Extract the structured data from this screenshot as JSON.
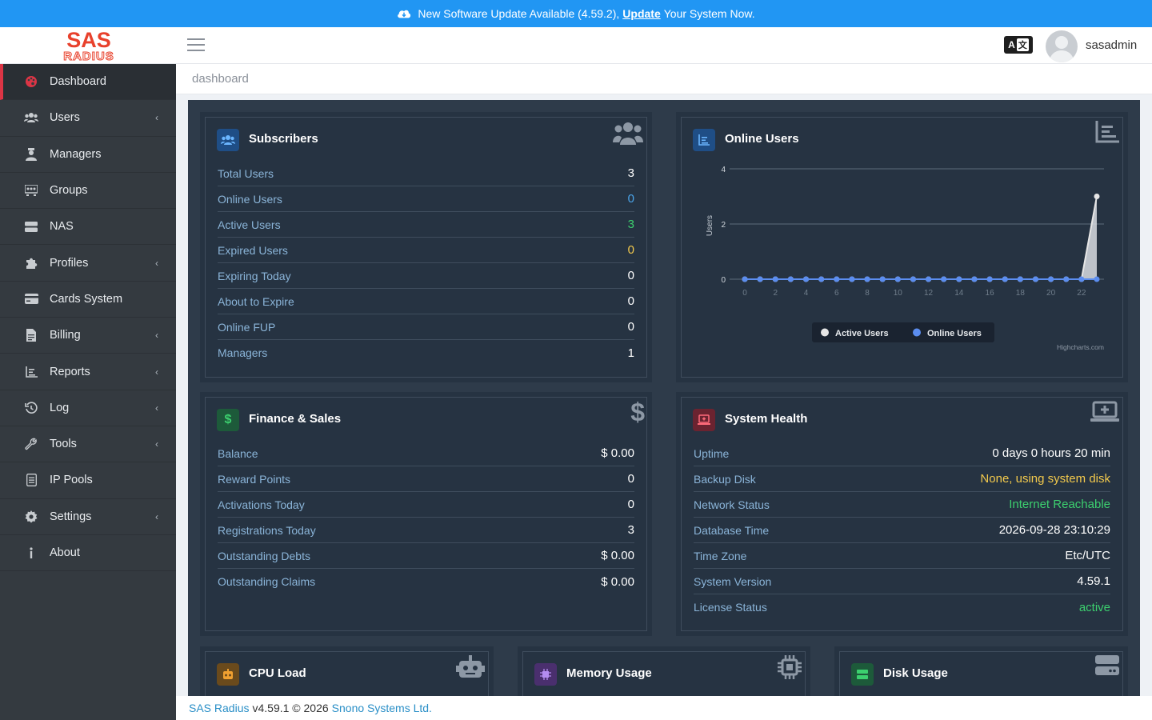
{
  "banner": {
    "prefix": "New Software Update Available (4.59.2),",
    "link": "Update",
    "suffix": "Your System Now."
  },
  "header": {
    "logo_top": "SAS",
    "logo_bottom": "RADIUS",
    "lang_a": "A",
    "lang_b": "文",
    "username": "sasadmin"
  },
  "sidebar": {
    "items": [
      {
        "label": "Dashboard",
        "icon": "palette-icon",
        "chevron": false,
        "active": true
      },
      {
        "label": "Users",
        "icon": "users-icon",
        "chevron": true
      },
      {
        "label": "Managers",
        "icon": "manager-icon",
        "chevron": false
      },
      {
        "label": "Groups",
        "icon": "groups-icon",
        "chevron": false
      },
      {
        "label": "NAS",
        "icon": "server-icon",
        "chevron": false
      },
      {
        "label": "Profiles",
        "icon": "puzzle-icon",
        "chevron": true
      },
      {
        "label": "Cards System",
        "icon": "card-icon",
        "chevron": false
      },
      {
        "label": "Billing",
        "icon": "invoice-icon",
        "chevron": true
      },
      {
        "label": "Reports",
        "icon": "chart-icon",
        "chevron": true
      },
      {
        "label": "Log",
        "icon": "history-icon",
        "chevron": true
      },
      {
        "label": "Tools",
        "icon": "wrench-icon",
        "chevron": true
      },
      {
        "label": "IP Pools",
        "icon": "list-icon",
        "chevron": false
      },
      {
        "label": "Settings",
        "icon": "gear-icon",
        "chevron": true
      },
      {
        "label": "About",
        "icon": "info-icon",
        "chevron": false
      }
    ],
    "chevron_glyph": "‹"
  },
  "breadcrumb": "dashboard",
  "subscribers": {
    "title": "Subscribers",
    "rows": [
      {
        "k": "Total Users",
        "v": "3",
        "color": "#ffffff"
      },
      {
        "k": "Online Users",
        "v": "0",
        "color": "#4aa3e8"
      },
      {
        "k": "Active Users",
        "v": "3",
        "color": "#3ccf6e"
      },
      {
        "k": "Expired Users",
        "v": "0",
        "color": "#f2c94c"
      },
      {
        "k": "Expiring Today",
        "v": "0",
        "color": "#ffffff"
      },
      {
        "k": "About to Expire",
        "v": "0",
        "color": "#ffffff"
      },
      {
        "k": "Online FUP",
        "v": "0",
        "color": "#ffffff"
      },
      {
        "k": "Managers",
        "v": "1",
        "color": "#ffffff"
      }
    ]
  },
  "online_users": {
    "title": "Online Users",
    "credit": "Highcharts.com"
  },
  "chart_data": {
    "type": "area",
    "ylabel": "Users",
    "ylim": [
      0,
      4
    ],
    "yticks": [
      "0",
      "2",
      "4"
    ],
    "xticks": [
      "0",
      "2",
      "4",
      "6",
      "8",
      "10",
      "12",
      "14",
      "16",
      "18",
      "20",
      "22"
    ],
    "x": [
      0,
      1,
      2,
      3,
      4,
      5,
      6,
      7,
      8,
      9,
      10,
      11,
      12,
      13,
      14,
      15,
      16,
      17,
      18,
      19,
      20,
      21,
      22,
      23
    ],
    "series": [
      {
        "name": "Active Users",
        "color": "#e6e6e6",
        "values": [
          0,
          0,
          0,
          0,
          0,
          0,
          0,
          0,
          0,
          0,
          0,
          0,
          0,
          0,
          0,
          0,
          0,
          0,
          0,
          0,
          0,
          0,
          0,
          3
        ]
      },
      {
        "name": "Online Users",
        "color": "#5b8def",
        "values": [
          0,
          0,
          0,
          0,
          0,
          0,
          0,
          0,
          0,
          0,
          0,
          0,
          0,
          0,
          0,
          0,
          0,
          0,
          0,
          0,
          0,
          0,
          0,
          0
        ]
      }
    ],
    "legend": "bottom-center"
  },
  "finance": {
    "title": "Finance & Sales",
    "rows": [
      {
        "k": "Balance",
        "v": "$ 0.00",
        "color": "#ffffff"
      },
      {
        "k": "Reward Points",
        "v": "0",
        "color": "#ffffff"
      },
      {
        "k": "Activations Today",
        "v": "0",
        "color": "#ffffff"
      },
      {
        "k": "Registrations Today",
        "v": "3",
        "color": "#ffffff"
      },
      {
        "k": "Outstanding Debts",
        "v": "$ 0.00",
        "color": "#ffffff"
      },
      {
        "k": "Outstanding Claims",
        "v": "$ 0.00",
        "color": "#ffffff"
      }
    ]
  },
  "health": {
    "title": "System Health",
    "rows": [
      {
        "k": "Uptime",
        "v": "0 days 0 hours 20 min",
        "color": "#ffffff"
      },
      {
        "k": "Backup Disk",
        "v": "None, using system disk",
        "color": "#f2c94c"
      },
      {
        "k": "Network Status",
        "v": "Internet Reachable",
        "color": "#3ccf6e"
      },
      {
        "k": "Database Time",
        "v": "2026-09-28 23:10:29",
        "color": "#ffffff"
      },
      {
        "k": "Time Zone",
        "v": "Etc/UTC",
        "color": "#ffffff"
      },
      {
        "k": "System Version",
        "v": "4.59.1",
        "color": "#ffffff"
      },
      {
        "k": "License Status",
        "v": "active",
        "color": "#3ccf6e"
      }
    ]
  },
  "cpu": {
    "title": "CPU Load"
  },
  "memory": {
    "title": "Memory Usage"
  },
  "disk": {
    "title": "Disk Usage"
  },
  "footer": {
    "brand": "SAS Radius",
    "text": "v4.59.1 © 2026",
    "company": "Snono Systems Ltd."
  }
}
